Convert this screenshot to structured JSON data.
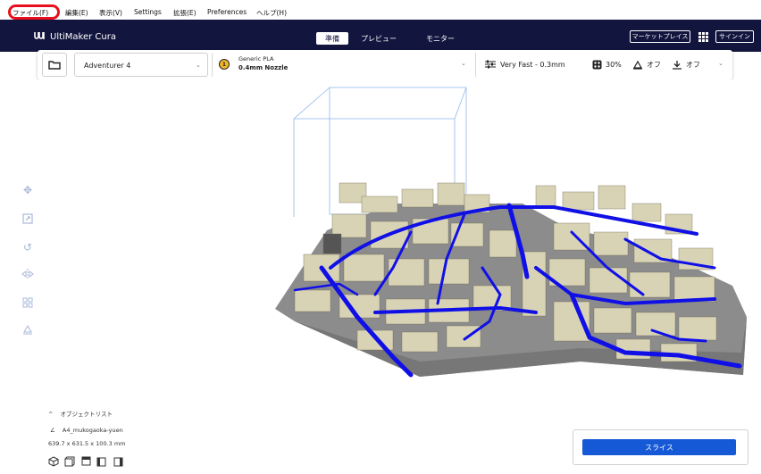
{
  "menu": {
    "file": "ファイル(F)",
    "edit": "編集(E)",
    "view": "表示(V)",
    "settings": "Settings",
    "extensions": "拡張(E)",
    "preferences": "Preferences",
    "help": "ヘルプ(H)"
  },
  "app": {
    "title": "UltiMaker Cura",
    "logo_mark": "ꟽ"
  },
  "stages": {
    "prepare": "準備",
    "preview": "プレビュー",
    "monitor": "モニター"
  },
  "header_buttons": {
    "marketplace": "マーケットプレイス",
    "signin": "サインイン"
  },
  "printer": {
    "name": "Adventurer 4"
  },
  "material": {
    "extruder_number": "1",
    "name": "Generic PLA",
    "nozzle": "0.4mm Nozzle"
  },
  "profile": {
    "quality": "Very Fast - 0.3mm",
    "infill": "30%",
    "support": "オフ",
    "adhesion": "オフ"
  },
  "object_list": {
    "title": "オブジェクトリスト",
    "filename": "A4_mukogaoka-yuen",
    "dimensions": "639.7 x 631.5 x 100.3 mm"
  },
  "slice": {
    "label": "スライス"
  },
  "colors": {
    "header_bg": "#12153d",
    "accent": "#1659d6",
    "highlight": "#e8101e",
    "road": "#1010e6",
    "plate": "#8c8c8c"
  }
}
